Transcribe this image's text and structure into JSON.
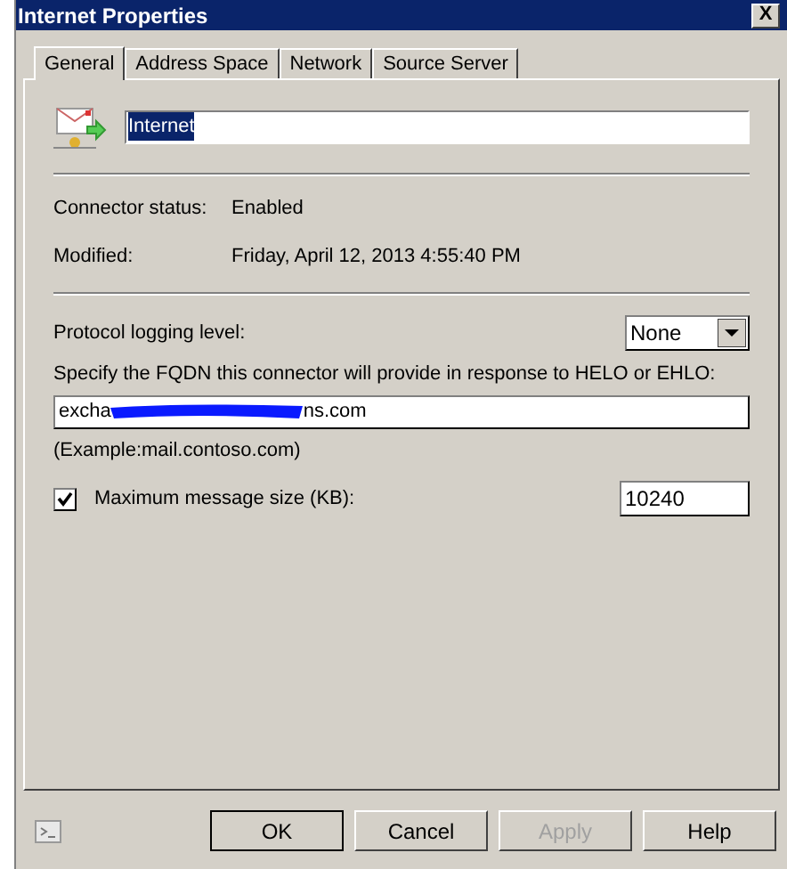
{
  "window": {
    "title": "Internet Properties",
    "close": "X"
  },
  "tabs": [
    {
      "label": "General",
      "selected": true
    },
    {
      "label": "Address Space",
      "selected": false
    },
    {
      "label": "Network",
      "selected": false
    },
    {
      "label": "Source Server",
      "selected": false
    }
  ],
  "name_field": {
    "value": "Internet",
    "selected": true
  },
  "info": [
    {
      "label": "Connector status:",
      "value": "Enabled"
    },
    {
      "label": "Modified:",
      "value": "Friday, April 12, 2013 4:55:40 PM"
    }
  ],
  "logging": {
    "label": "Protocol logging level:",
    "value": "None"
  },
  "fqdn": {
    "label": "Specify the FQDN this connector will provide in response to HELO or EHLO:",
    "value_start": "excha",
    "value_end": "ns.com",
    "redacted": true,
    "hint": "(Example:mail.contoso.com)"
  },
  "max_size": {
    "label": "Maximum message size (KB):",
    "checked": true,
    "value": "10240"
  },
  "buttons": [
    {
      "label": "OK",
      "disabled": false,
      "default": true
    },
    {
      "label": "Cancel",
      "disabled": false,
      "default": false
    },
    {
      "label": "Apply",
      "disabled": true,
      "default": false
    },
    {
      "label": "Help",
      "disabled": false,
      "default": false
    }
  ]
}
